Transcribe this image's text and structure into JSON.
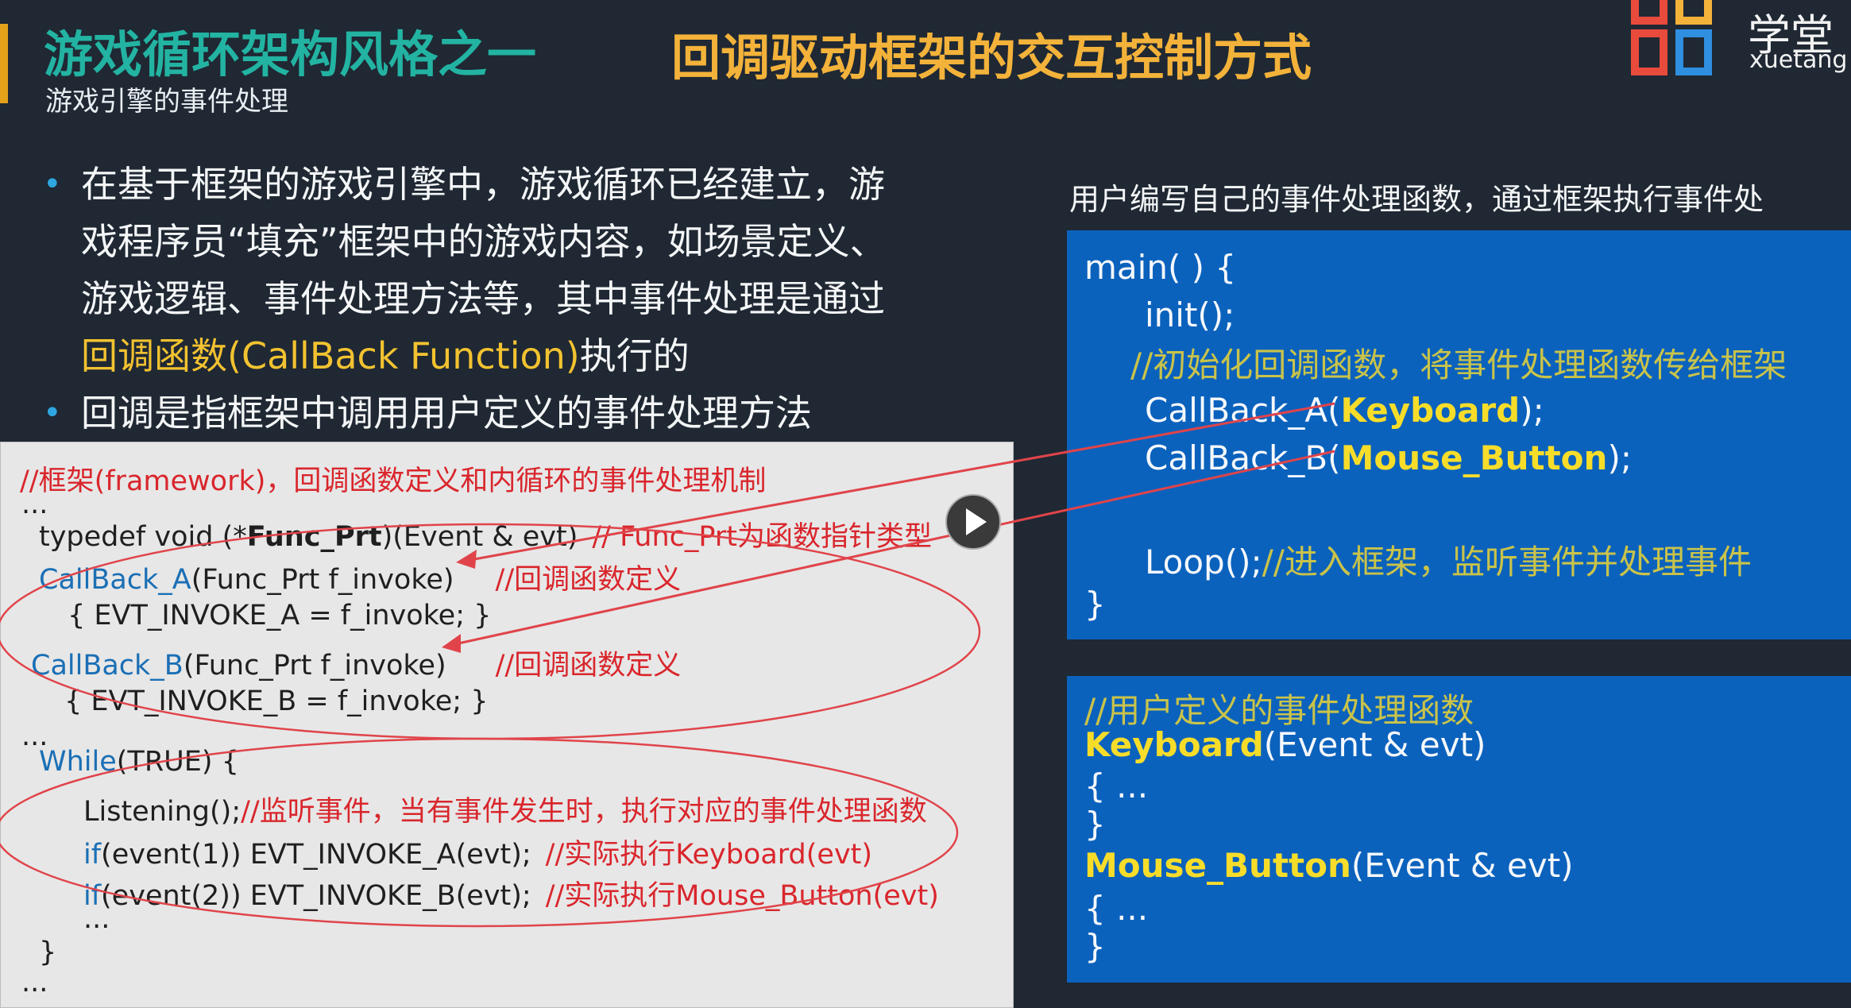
{
  "header": {
    "title_left": "游戏循环架构风格之一",
    "title_right": "回调驱动框架的交互控制方式",
    "subtitle": "游戏引擎的事件处理",
    "logo_text": "学堂",
    "logo_sub": "xuetang"
  },
  "bullets": [
    {
      "line1": "在基于框架的游戏引擎中，游戏循环已经建立，游",
      "line2": "戏程序员“填充”框架中的游戏内容，如场景定义、",
      "line3": "游戏逻辑、事件处理方法等，其中事件处理是通过",
      "highlight": "回调函数(CallBack Function)",
      "tail": "执行的"
    },
    {
      "text": "回调是指框架中调用用户定义的事件处理方法"
    }
  ],
  "framework_code": {
    "comment": "//框架(framework)，回调函数定义和内循环的事件处理机制",
    "ellipsis1": "...",
    "typedef_prefix": "typedef void  (*",
    "typedef_bold": "Func_Prt",
    "typedef_suffix": ")(Event & evt)",
    "typedef_comment": "// Func_Prt为函数指针类型",
    "cb_a_name": "CallBack_A",
    "cb_a_args": "(Func_Prt    f_invoke)",
    "cb_a_comment": "//回调函数定义",
    "cb_a_body": "{ EVT_INVOKE_A =  f_invoke;  }",
    "cb_b_name": "CallBack_B",
    "cb_b_args": "(Func_Prt    f_invoke)",
    "cb_b_comment": "//回调函数定义",
    "cb_b_body": "{ EVT_INVOKE_B =  f_invoke;  }",
    "ellipsis2": "...",
    "while_kw": "While",
    "while_rest": "(TRUE) {",
    "listening": "Listening();",
    "listening_comment": "//监听事件，当有事件发生时，执行对应的事件处理函数",
    "if_kw1": "if",
    "if1_rest": "(event(1)) EVT_INVOKE_A(evt);",
    "if1_comment": "//实际执行Keyboard(evt)",
    "if_kw2": "if",
    "if2_rest": "(event(2)) EVT_INVOKE_B(evt);",
    "if2_comment": "//实际执行Mouse_Button(evt)",
    "ellipsis3": "...",
    "close_brace": "}",
    "ellipsis4": "..."
  },
  "right": {
    "caption": "用户编写自己的事件处理函数，通过框架执行事件处",
    "main_code": {
      "line1": "main( ) {",
      "line2": "init();",
      "comment": "//初始化回调函数，将事件处理函数传给框架",
      "cb_a_prefix": "CallBack_A(",
      "cb_a_arg": "Keyboard",
      "cb_a_suffix": ");",
      "cb_b_prefix": "CallBack_B(",
      "cb_b_arg": "Mouse_Button",
      "cb_b_suffix": ");",
      "loop": "Loop();",
      "loop_comment": "//进入框架，监听事件并处理事件",
      "close": "}"
    },
    "handlers_code": {
      "comment": "//用户定义的事件处理函数",
      "kb_name": "Keyboard",
      "kb_args": "(Event & evt)",
      "kb_open": "{    ...",
      "kb_close": "}",
      "mb_name": "Mouse_Button",
      "mb_args": "(Event & evt)",
      "mb_open": "{    ...",
      "mb_close": "}"
    }
  },
  "colors": {
    "background": "#1f2833",
    "title_teal": "#23b3a2",
    "title_orange": "#f3b23a",
    "panel_blue": "#0b62bd",
    "code_red": "#d9262c"
  }
}
